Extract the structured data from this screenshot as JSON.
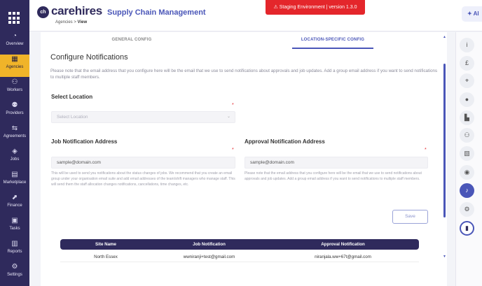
{
  "leftnav": {
    "items": [
      {
        "label": "Overview",
        "icon": "◔"
      },
      {
        "label": "Agencies",
        "icon": "▦"
      },
      {
        "label": "Workers",
        "icon": "⚇"
      },
      {
        "label": "Providers",
        "icon": "⚉"
      },
      {
        "label": "Agreements",
        "icon": "⇆"
      },
      {
        "label": "Jobs",
        "icon": "◈"
      },
      {
        "label": "Marketplace",
        "icon": "▤"
      },
      {
        "label": "Finance",
        "icon": "⬈"
      },
      {
        "label": "Tasks",
        "icon": "▣"
      },
      {
        "label": "Reports",
        "icon": "▥"
      },
      {
        "label": "Settings",
        "icon": "⚙"
      }
    ]
  },
  "header": {
    "logo_badge": "ch",
    "logo_text": "carehires",
    "app_title": "Supply Chain Management",
    "breadcrumb_parent": "Agencies",
    "breadcrumb_sep": ">",
    "breadcrumb_current": "View",
    "env_banner": "⚠  Staging Environment | version 1.3.0",
    "ai_label": "✦ AI"
  },
  "tabs": [
    {
      "label": "GENERAL CONFIG",
      "active": false
    },
    {
      "label": "LOCATION-SPECIFIC CONFIG",
      "active": true
    }
  ],
  "section": {
    "title": "Configure Notifications",
    "intro": "Please note that the email address that you configure here will be the email that we use to send notifications about approvals and job updates. Add a group email address if you want to send notifications to multiple staff members."
  },
  "location": {
    "label": "Select Location",
    "required": "*",
    "placeholder": "Select Location",
    "chevron": "⌄"
  },
  "job_notification": {
    "label": "Job Notification Address",
    "required": "*",
    "placeholder": "sample@domain.com",
    "help": "This will be used to send you notifications about the status changes of jobs. We recommend that you create an email group under your organisation email suite and add email addresses of the team/shift managers who manage staff. This will send them the staff allocation changes notifications, cancellations, time changes, etc."
  },
  "approval_notification": {
    "label": "Approval Notification Address",
    "required": "*",
    "placeholder": "sample@domain.com",
    "help": "Please note that the email address that you configure here will be the email that we use to send notifications about approvals and job updates. Add a group email address if you want to send notifications to multiple staff members."
  },
  "save_label": "Save",
  "table": {
    "headers": [
      "Site Name",
      "Job Notification",
      "Approval Notification"
    ],
    "rows": [
      [
        "North Essex",
        "wwniranji+test@gmail.com",
        "niranjala.ww+67t@gmail.com"
      ]
    ]
  },
  "scrollbar": {
    "up": "▲",
    "down": "▼"
  },
  "rightrail": [
    {
      "icon": "i",
      "name": "info-icon"
    },
    {
      "icon": "£",
      "name": "pound-icon"
    },
    {
      "icon": "⌖",
      "name": "location-pin-icon"
    },
    {
      "icon": "●",
      "name": "user-icon"
    },
    {
      "icon": "▙",
      "name": "building-icon"
    },
    {
      "icon": "⚇",
      "name": "group-icon"
    },
    {
      "icon": "▧",
      "name": "clipboard-icon"
    },
    {
      "icon": "◉",
      "name": "person-badge-icon"
    },
    {
      "icon": "♪",
      "name": "bell-icon"
    },
    {
      "icon": "⚙",
      "name": "settings-icon"
    },
    {
      "icon": "▮",
      "name": "book-icon"
    }
  ],
  "colors": {
    "nav_bg": "#2f2a5c",
    "active_nav": "#f0b429",
    "accent": "#4a56b8",
    "banner": "#e4262b"
  }
}
